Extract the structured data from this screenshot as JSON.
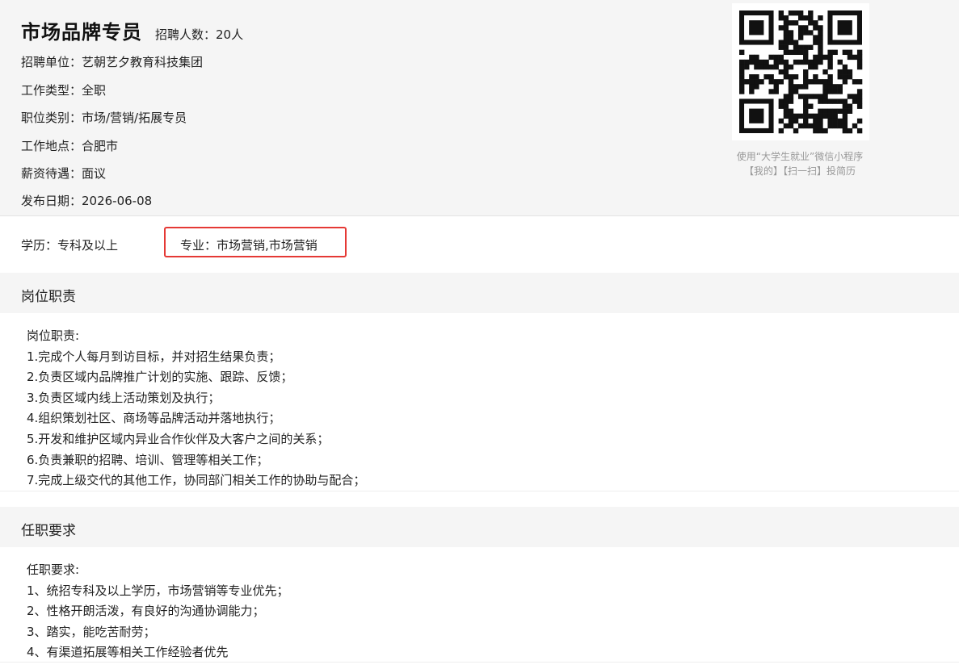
{
  "job": {
    "title": "市场品牌专员",
    "headcount": "招聘人数：20人",
    "info": [
      "招聘单位：艺朝艺夕教育科技集团",
      "工作类型：全职",
      "职位类别：市场/营销/拓展专员",
      "工作地点：合肥市",
      "薪资待遇：面议",
      "发布日期：2026-06-08"
    ]
  },
  "qr": {
    "icon": "qr-code-icon",
    "caption_line1": "使用“大学生就业”微信小程序",
    "caption_line2": "【我的】【扫一扫】投简历"
  },
  "education": {
    "degree": "学历：专科及以上",
    "major": "专业：市场营销,市场营销",
    "highlight_color": "#e53935"
  },
  "duties": {
    "heading": "岗位职责",
    "lines": [
      "岗位职责:",
      "1.完成个人每月到访目标，并对招生结果负责；",
      "2.负责区域内品牌推广计划的实施、跟踪、反馈；",
      "3.负责区域内线上活动策划及执行；",
      "4.组织策划社区、商场等品牌活动并落地执行；",
      "5.开发和维护区域内异业合作伙伴及大客户之间的关系；",
      "6.负责兼职的招聘、培训、管理等相关工作；",
      "7.完成上级交代的其他工作，协同部门相关工作的协助与配合；"
    ]
  },
  "requirements": {
    "heading": "任职要求",
    "lines": [
      "任职要求:",
      "1、统招专科及以上学历，市场营销等专业优先；",
      "2、性格开朗活泼，有良好的沟通协调能力；",
      "3、踏实，能吃苦耐劳；",
      "4、有渠道拓展等相关工作经验者优先"
    ]
  }
}
